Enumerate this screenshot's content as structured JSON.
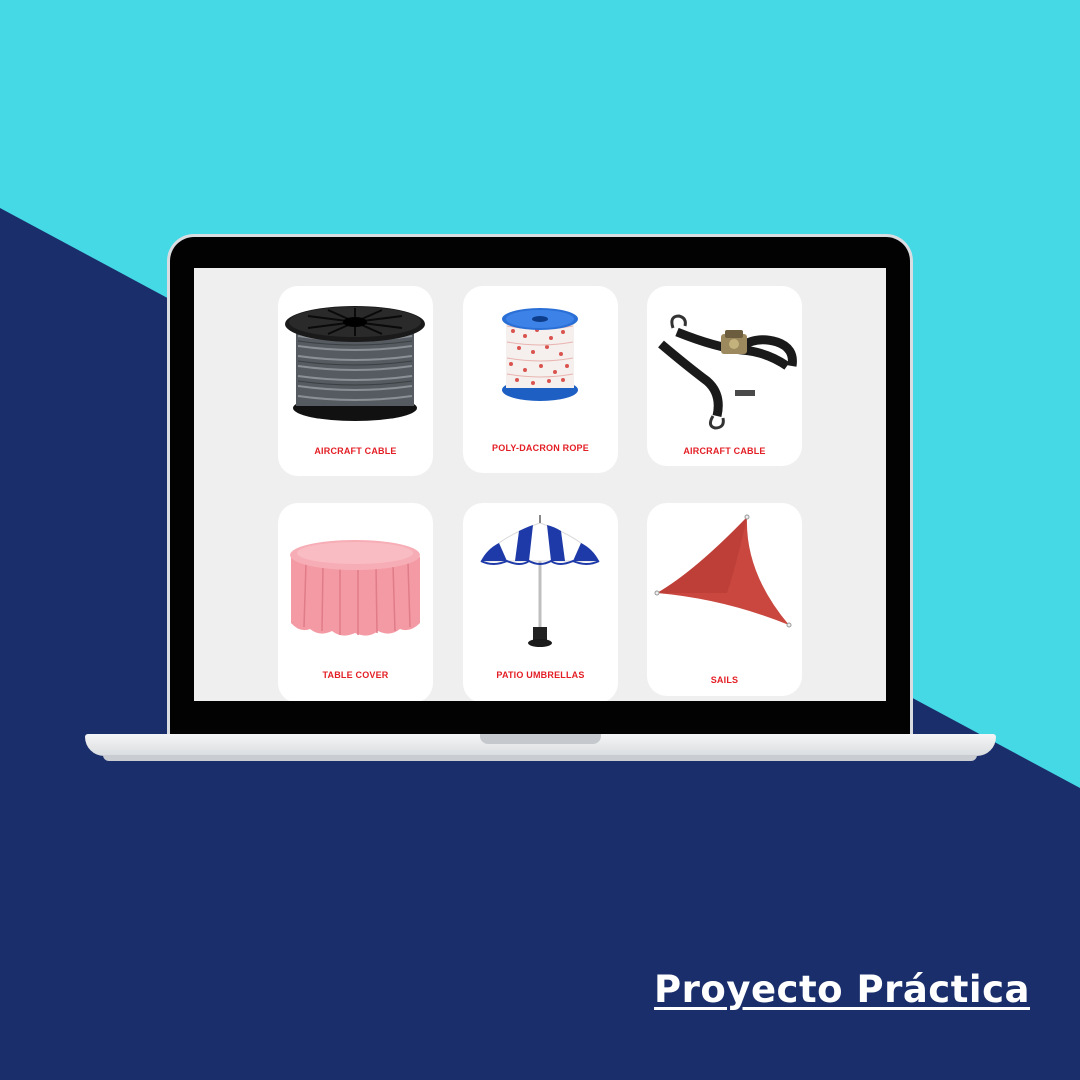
{
  "colors": {
    "background_light": "#45d9e6",
    "background_dark": "#1a2e6b",
    "label_red": "#e31e24",
    "screen_bg": "#efeff0"
  },
  "products": [
    {
      "label": "AIRCRAFT CABLE",
      "icon": "cable-reel-icon"
    },
    {
      "label": "POLY-DACRON ROPE",
      "icon": "rope-spool-icon"
    },
    {
      "label": "AIRCRAFT CABLE",
      "icon": "ratchet-strap-icon"
    },
    {
      "label": "TABLE COVER",
      "icon": "table-cover-icon"
    },
    {
      "label": "PATIO UMBRELLAS",
      "icon": "patio-umbrella-icon"
    },
    {
      "label": "SAILS",
      "icon": "shade-sail-icon"
    }
  ],
  "brand": {
    "text": "Proyecto Práctica"
  }
}
